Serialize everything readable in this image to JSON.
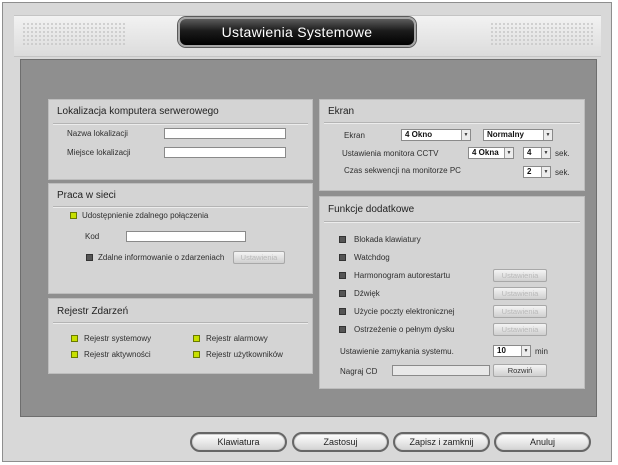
{
  "window": {
    "title": "Ustawienia Systemowe"
  },
  "location_panel": {
    "title": "Lokalizacja komputera serwerowego",
    "name_label": "Nazwa lokalizacji",
    "name_value": "",
    "place_label": "Miejsce lokalizacji",
    "place_value": ""
  },
  "network_panel": {
    "title": "Praca w sieci",
    "remote_sharing_label": "Udostępnienie zdalnego połączenia",
    "remote_sharing_checked": true,
    "code_label": "Kod",
    "code_value": "",
    "remote_notify_label": "Zdalne informowanie o zdarzeniach",
    "remote_notify_checked": false,
    "settings_button": "Ustawienia"
  },
  "log_panel": {
    "title": "Rejestr Zdarzeń",
    "items": [
      {
        "label": "Rejestr systemowy",
        "checked": true
      },
      {
        "label": "Rejestr alarmowy",
        "checked": true
      },
      {
        "label": "Rejestr aktywności",
        "checked": true
      },
      {
        "label": "Rejestr użytkowników",
        "checked": true
      }
    ]
  },
  "screen_panel": {
    "title": "Ekran",
    "screen_label": "Ekran",
    "screen_value": "4 Okno",
    "mode_value": "Normalny",
    "cctv_label": "Ustawienia monitora CCTV",
    "cctv_value": "4 Okna",
    "cctv_seconds": "4",
    "cctv_unit": "sek.",
    "sequence_label": "Czas sekwencji na monitorze PC",
    "sequence_seconds": "2",
    "sequence_unit": "sek."
  },
  "extra_panel": {
    "title": "Funkcje dodatkowe",
    "keyboard_lock": "Blokada klawiatury",
    "watchdog": "Watchdog",
    "restart_schedule": "Harmonogram autorestartu",
    "sound": "Dźwięk",
    "email": "Użycie poczty elektronicznej",
    "disk_warning": "Ostrzeżenie o pełnym dysku",
    "settings_button": "Ustawienia",
    "shutdown_label": "Ustawienie zamykania systemu.",
    "shutdown_value": "10",
    "shutdown_unit": "min",
    "cd_label": "Nagraj CD",
    "cd_value": "",
    "expand_button": "Rozwiń"
  },
  "footer": {
    "keyboard": "Klawiatura",
    "apply": "Zastosuj",
    "save_close": "Zapisz i zamknij",
    "cancel": "Anuluj"
  },
  "colors": {
    "checkbox_on": "#c8e000",
    "checkbox_off": "#555555",
    "main_background": "#8f8f8f",
    "panel_background": "#d4d4d4",
    "title_plate": "#000000"
  }
}
